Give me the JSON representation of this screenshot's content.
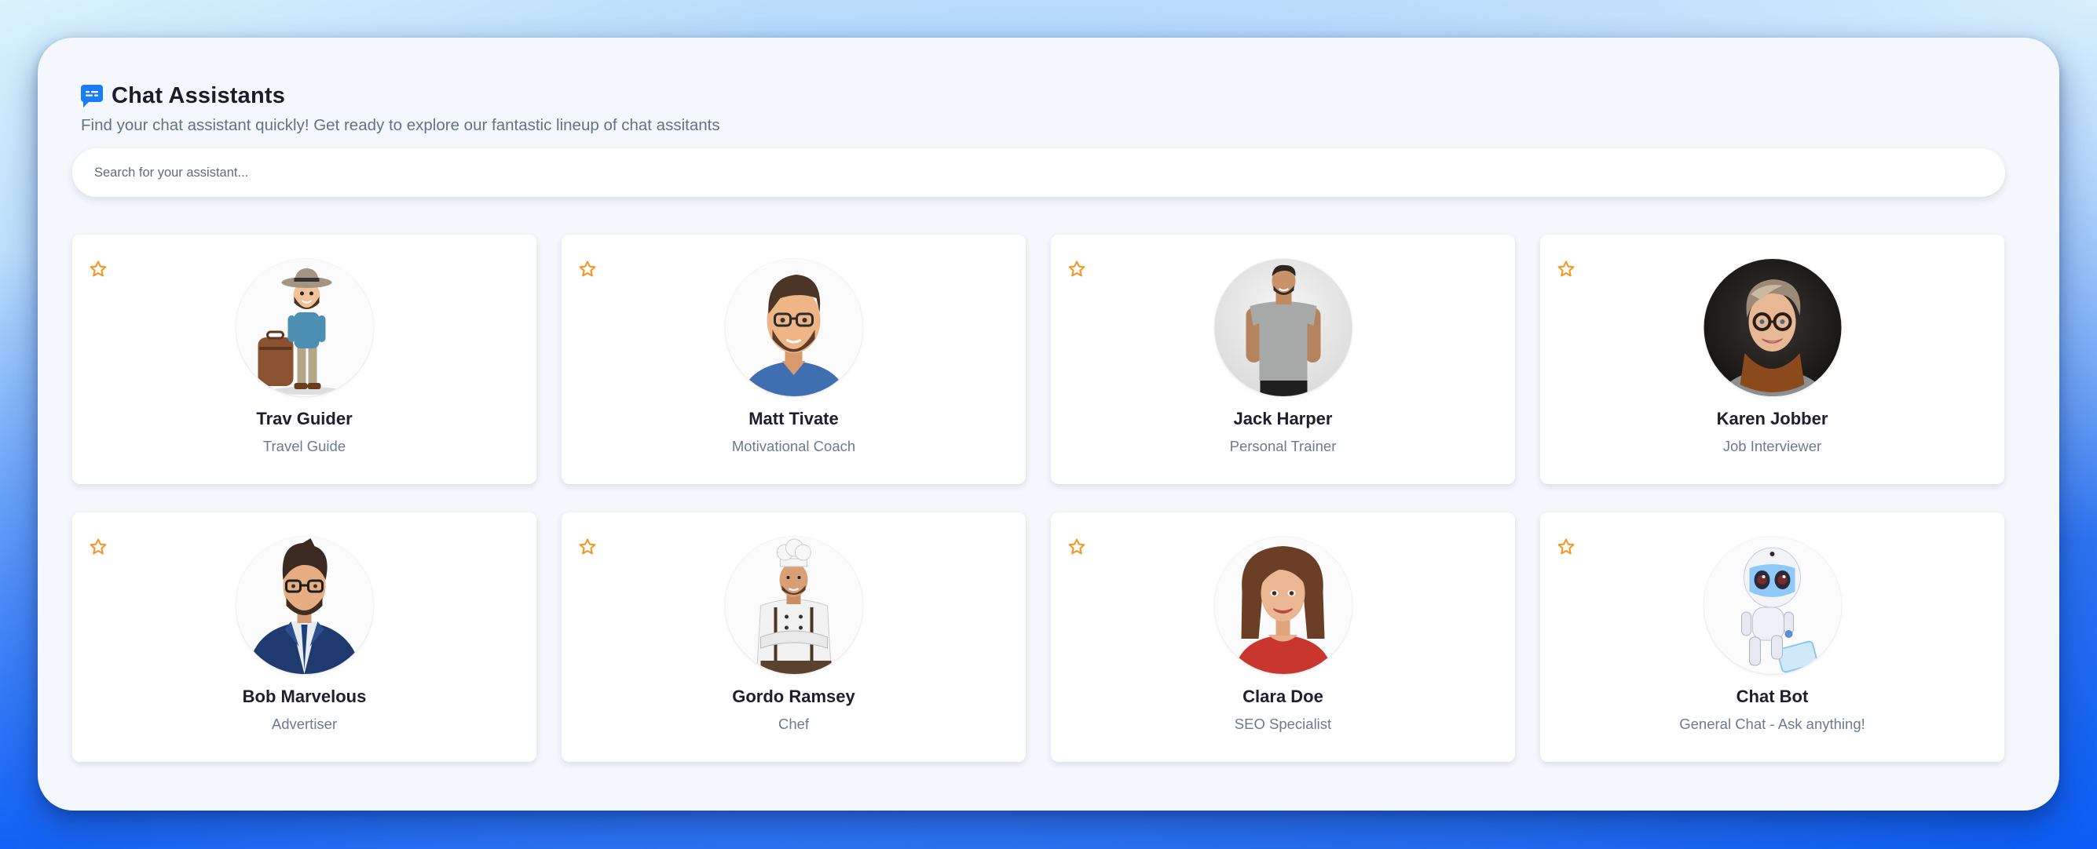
{
  "header": {
    "title": "Chat Assistants",
    "subtitle": "Find your chat assistant quickly! Get ready to explore our fantastic lineup of chat assitants",
    "icon": "chat-bubble-icon"
  },
  "search": {
    "placeholder": "Search for your assistant...",
    "value": ""
  },
  "colors": {
    "accent": "#1a7cf7",
    "star": "#f7931e",
    "name_text": "#1e1e2d",
    "role_text": "#6b7a90",
    "panel_bg": "#f4f7fb"
  },
  "assistants": [
    {
      "name": "Trav Guider",
      "role": "Travel Guide",
      "favorite": false,
      "avatar": "travel-guide-avatar"
    },
    {
      "name": "Matt Tivate",
      "role": "Motivational Coach",
      "favorite": false,
      "avatar": "motivational-coach-avatar"
    },
    {
      "name": "Jack Harper",
      "role": "Personal Trainer",
      "favorite": false,
      "avatar": "personal-trainer-avatar"
    },
    {
      "name": "Karen Jobber",
      "role": "Job Interviewer",
      "favorite": false,
      "avatar": "job-interviewer-avatar"
    },
    {
      "name": "Bob Marvelous",
      "role": "Advertiser",
      "favorite": false,
      "avatar": "advertiser-avatar"
    },
    {
      "name": "Gordo Ramsey",
      "role": "Chef",
      "favorite": false,
      "avatar": "chef-avatar"
    },
    {
      "name": "Clara Doe",
      "role": "SEO Specialist",
      "favorite": false,
      "avatar": "seo-specialist-avatar"
    },
    {
      "name": "Chat Bot",
      "role": "General Chat - Ask anything!",
      "favorite": false,
      "avatar": "robot-avatar"
    }
  ]
}
